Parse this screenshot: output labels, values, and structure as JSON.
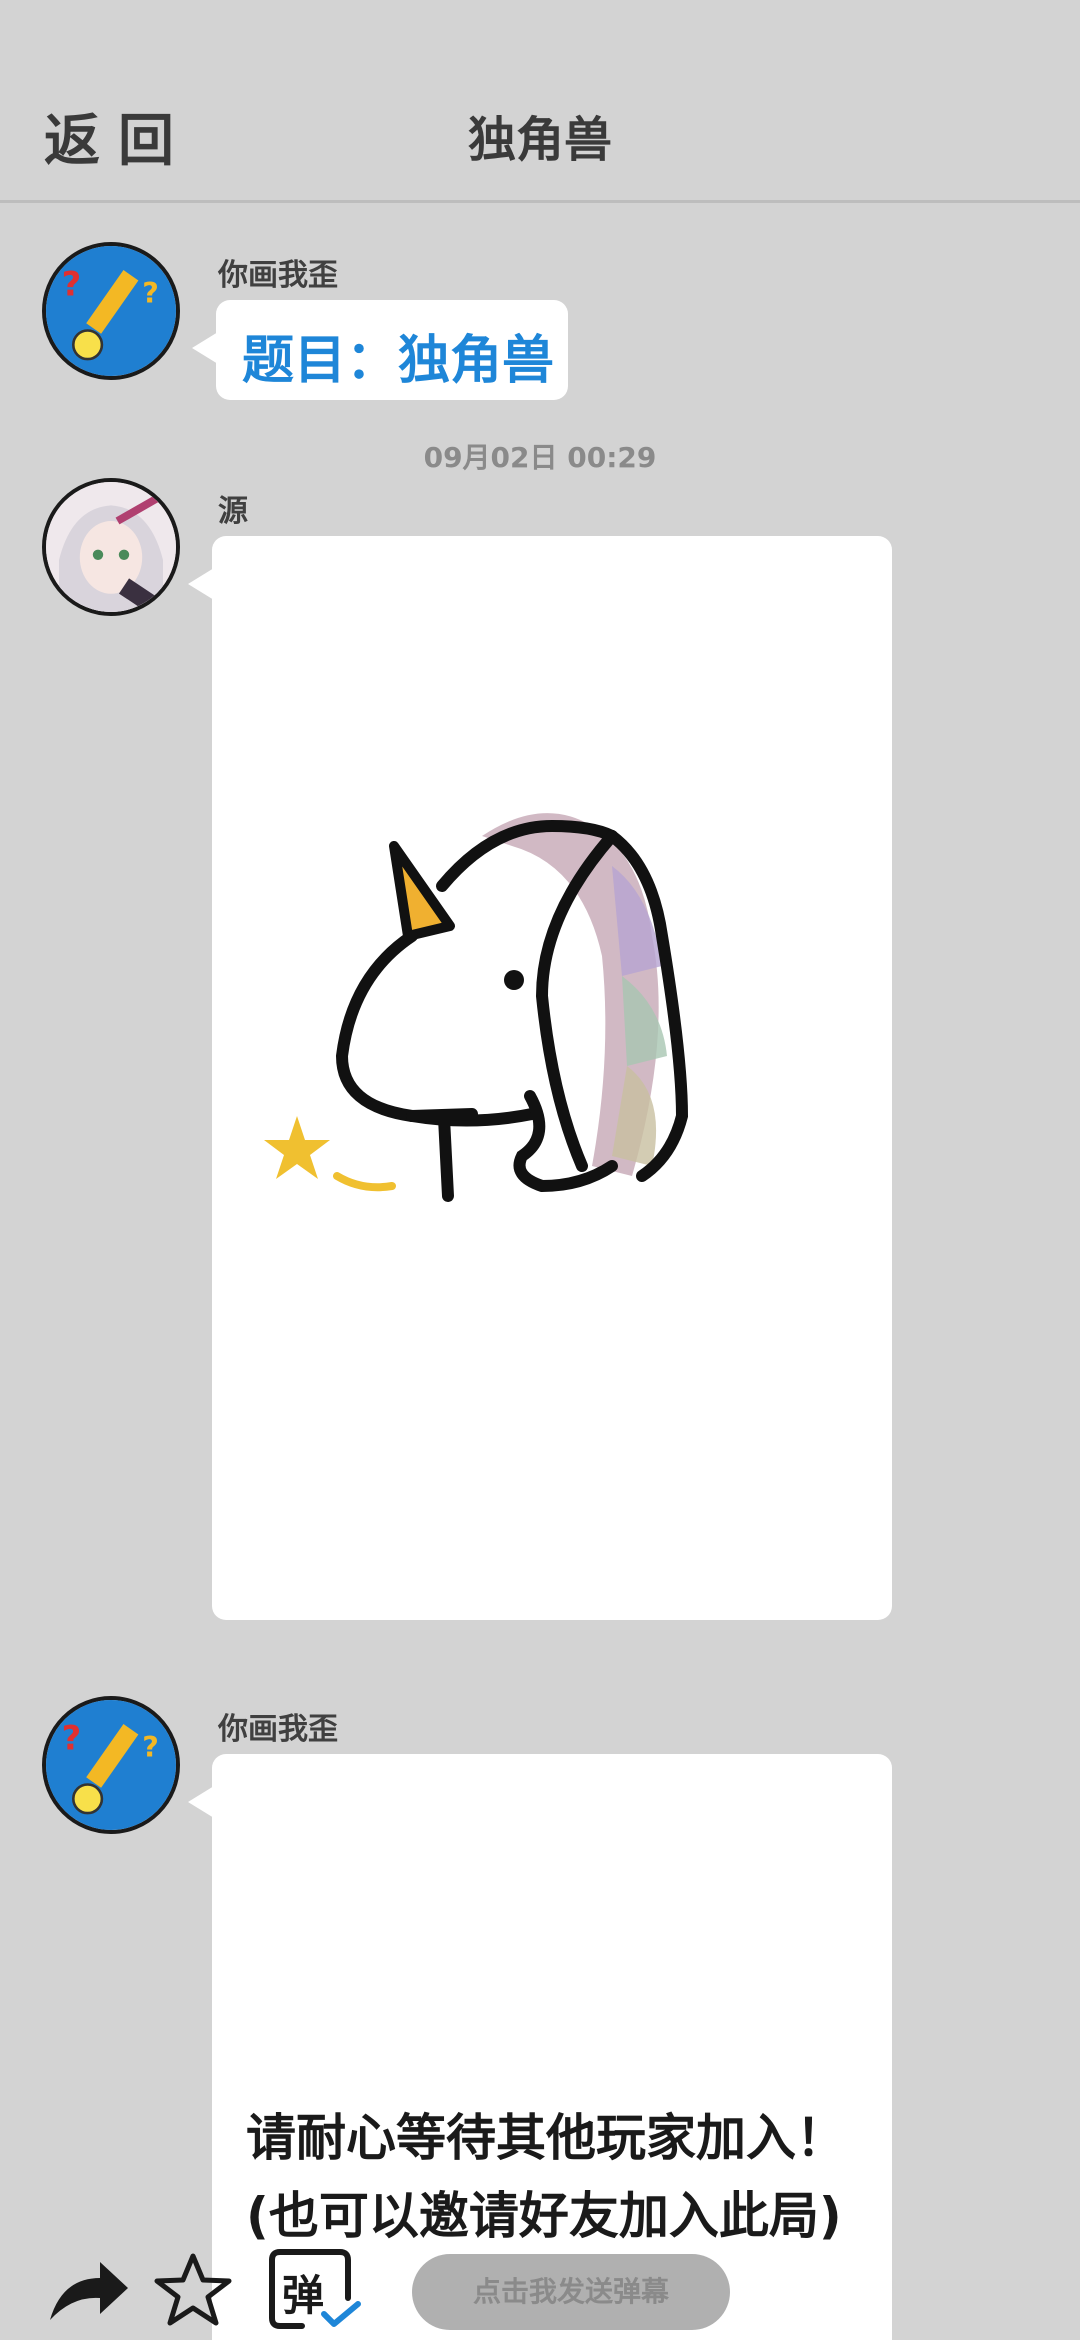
{
  "header": {
    "back_label": "返回",
    "title": "独角兽"
  },
  "messages": [
    {
      "sender": "你画我歪",
      "text": "题目：独角兽"
    },
    {
      "timestamp": "09月02日  00:29"
    },
    {
      "sender": "源",
      "image": "unicorn-drawing"
    },
    {
      "sender": "你画我歪",
      "text_line1": "请耐心等待其他玩家加入！",
      "text_line2": "(也可以邀请好友加入此局)"
    }
  ],
  "bottom_bar": {
    "share_icon": "share-arrow-icon",
    "favorite_icon": "star-icon",
    "danmu_icon_label": "弹",
    "danmu_placeholder": "点击我发送弹幕"
  },
  "colors": {
    "accent": "#1e86d8",
    "background": "#d3d3d3"
  }
}
